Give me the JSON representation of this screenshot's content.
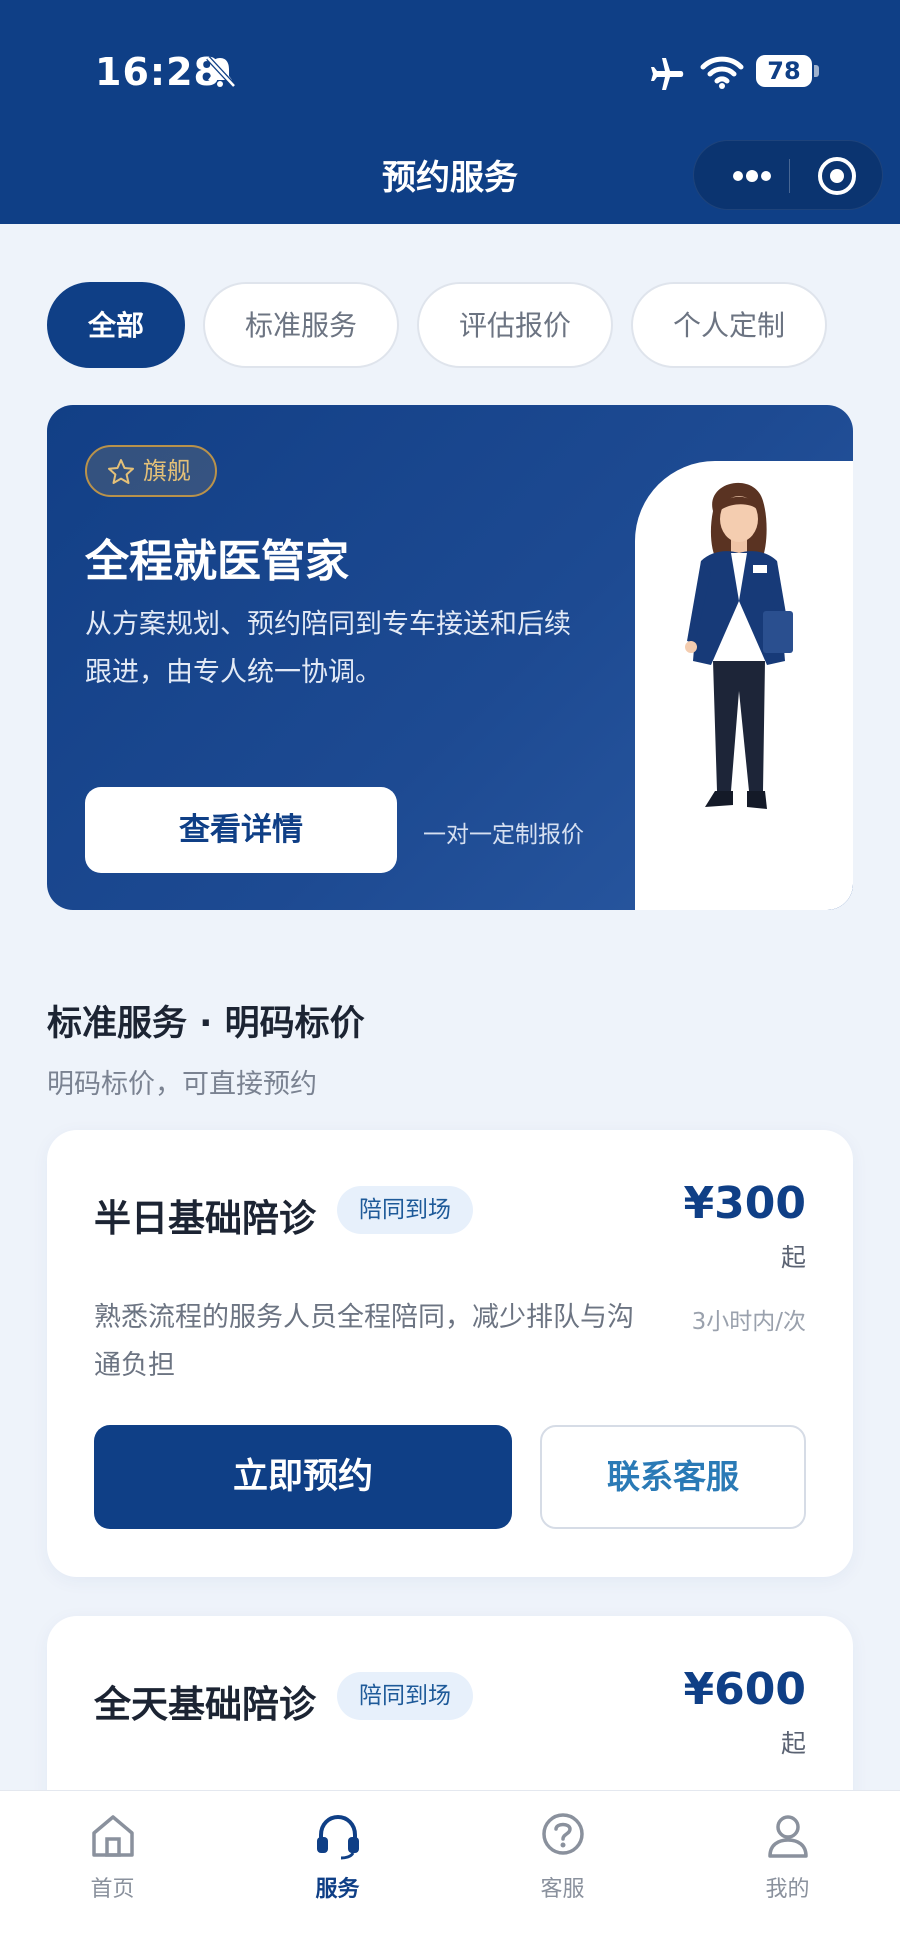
{
  "status_bar": {
    "time": "16:28",
    "battery": "78"
  },
  "nav": {
    "title": "预约服务"
  },
  "filter_tabs": [
    {
      "label": "全部",
      "active": true
    },
    {
      "label": "标准服务",
      "active": false
    },
    {
      "label": "评估报价",
      "active": false
    },
    {
      "label": "个人定制",
      "active": false
    }
  ],
  "banner": {
    "badge": "旗舰",
    "title": "全程就医管家",
    "description": "从方案规划、预约陪同到专车接送和后续跟进，由专人统一协调。",
    "button": "查看详情",
    "note": "一对一定制报价"
  },
  "section": {
    "title": "标准服务 · 明码标价",
    "subtitle": "明码标价，可直接预约"
  },
  "services": [
    {
      "name": "半日基础陪诊",
      "tag": "陪同到场",
      "price": "¥300",
      "price_unit": "起",
      "description": "熟悉流程的服务人员全程陪同，减少排队与沟通负担",
      "duration": "3小时内/次",
      "book_button": "立即预约",
      "contact_button": "联系客服"
    },
    {
      "name": "全天基础陪诊",
      "tag": "陪同到场",
      "price": "¥600",
      "price_unit": "起"
    }
  ],
  "tabbar": [
    {
      "label": "首页",
      "icon": "home-icon",
      "active": false
    },
    {
      "label": "服务",
      "icon": "headset-icon",
      "active": true
    },
    {
      "label": "客服",
      "icon": "help-icon",
      "active": false
    },
    {
      "label": "我的",
      "icon": "user-icon",
      "active": false
    }
  ],
  "colors": {
    "primary": "#0f3f86",
    "accent_gold": "#e4c078",
    "link": "#2a7ab6"
  }
}
